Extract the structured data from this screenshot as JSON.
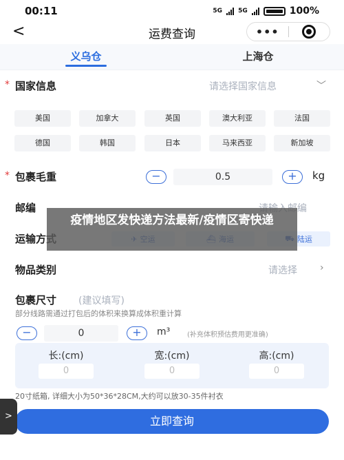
{
  "status_bar": {
    "time": "00:11",
    "signal1": "5G",
    "signal2": "5G",
    "battery": "100%"
  },
  "nav": {
    "title": "运费查询",
    "back_glyph": "<",
    "more_glyph": "•••"
  },
  "warehouse_tabs": [
    {
      "label": "义乌仓",
      "active": true
    },
    {
      "label": "上海仓",
      "active": false
    }
  ],
  "country": {
    "label": "国家信息",
    "placeholder": "请选择国家信息",
    "options": [
      "美国",
      "加拿大",
      "英国",
      "澳大利亚",
      "法国",
      "德国",
      "韩国",
      "日本",
      "马来西亚",
      "新加坡"
    ]
  },
  "weight": {
    "label": "包裹毛重",
    "value": "0.5",
    "unit": "kg",
    "minus": "−",
    "plus": "+"
  },
  "postal": {
    "label": "邮编",
    "placeholder": "请输入邮编"
  },
  "shipping": {
    "label": "运输方式",
    "options": [
      "空运",
      "海运",
      "陆运"
    ]
  },
  "category": {
    "label": "物品类别",
    "placeholder": "请选择"
  },
  "size": {
    "label": "包裹尺寸",
    "hint": "(建议填写)",
    "note": "部分线路需通过打包后的体积来换算成体积重计算",
    "volume_value": "0",
    "volume_unit": "m³",
    "volume_hint": "(补充体积预估费用更准确)",
    "length_label": "长:(cm)",
    "width_label": "宽:(cm)",
    "height_label": "高:(cm)",
    "length_value": "0",
    "width_value": "0",
    "height_value": "0",
    "carton_note": "20寸纸箱, 详细大小为50*36*28CM,大约可以放30-35件衬衣"
  },
  "submit_label": "立即查询",
  "overlay_text": "疫情地区发快递方法最新/疫情区寄快递",
  "side_tab_glyph": ">",
  "colors": {
    "accent": "#2f6de0",
    "required": "#e23b3b"
  }
}
